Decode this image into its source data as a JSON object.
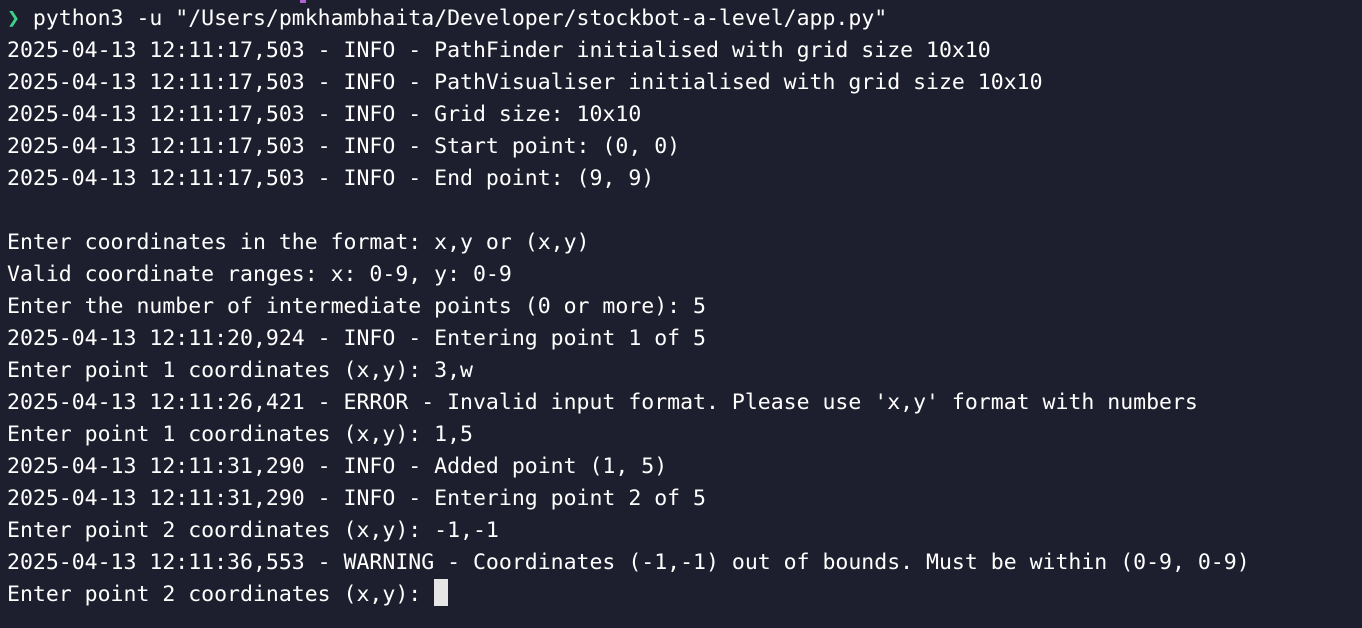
{
  "terminal": {
    "prompt": {
      "arrow": "❯",
      "command": " python3 -u \"/Users/pmkhambhaita/Developer/stockbot-a-level/app.py\""
    },
    "lines": [
      "2025-04-13 12:11:17,503 - INFO - PathFinder initialised with grid size 10x10",
      "2025-04-13 12:11:17,503 - INFO - PathVisualiser initialised with grid size 10x10",
      "2025-04-13 12:11:17,503 - INFO - Grid size: 10x10",
      "2025-04-13 12:11:17,503 - INFO - Start point: (0, 0)",
      "2025-04-13 12:11:17,503 - INFO - End point: (9, 9)",
      "",
      "Enter coordinates in the format: x,y or (x,y)",
      "Valid coordinate ranges: x: 0-9, y: 0-9",
      "Enter the number of intermediate points (0 or more): 5",
      "2025-04-13 12:11:20,924 - INFO - Entering point 1 of 5",
      "Enter point 1 coordinates (x,y): 3,w",
      "2025-04-13 12:11:26,421 - ERROR - Invalid input format. Please use 'x,y' format with numbers",
      "Enter point 1 coordinates (x,y): 1,5",
      "2025-04-13 12:11:31,290 - INFO - Added point (1, 5)",
      "2025-04-13 12:11:31,290 - INFO - Entering point 2 of 5",
      "Enter point 2 coordinates (x,y): -1,-1",
      "2025-04-13 12:11:36,553 - WARNING - Coordinates (-1,-1) out of bounds. Must be within (0-9, 0-9)"
    ],
    "current_prompt": "Enter point 2 coordinates (x,y): "
  },
  "colors": {
    "background": "#1e1f2e",
    "text": "#ffffff",
    "prompt_arrow": "#3ed18a",
    "cursor": "#e6e6e6"
  }
}
